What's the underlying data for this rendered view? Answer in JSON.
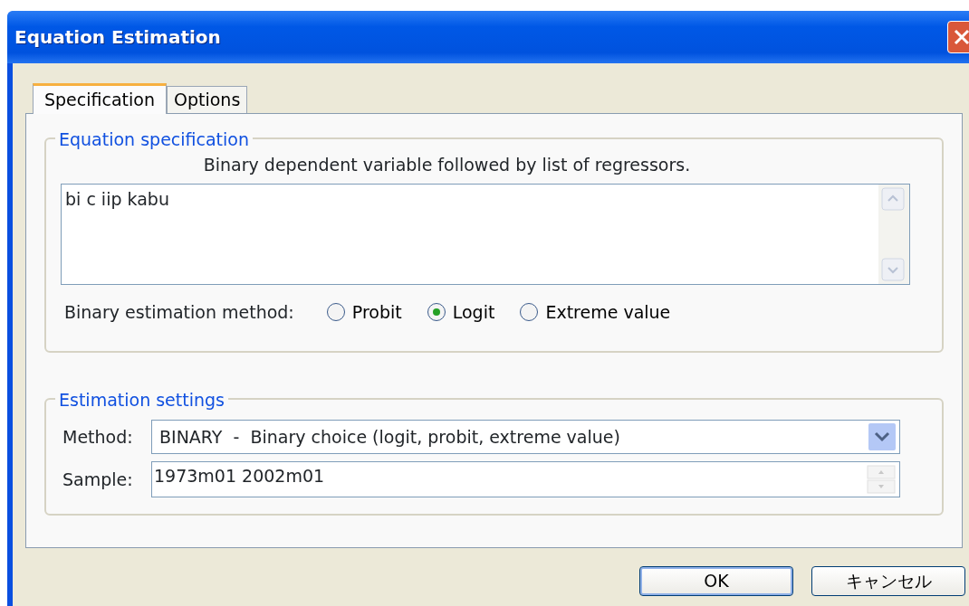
{
  "window": {
    "title": "Equation Estimation"
  },
  "tabs": [
    {
      "label": "Specification",
      "selected": true
    },
    {
      "label": "Options",
      "selected": false
    }
  ],
  "equation_specification": {
    "legend": "Equation specification",
    "instruction": "Binary dependent variable followed by list of regressors.",
    "equation": "bi c iip kabu",
    "method_label": "Binary estimation method:",
    "methods": [
      {
        "label": "Probit",
        "selected": false
      },
      {
        "label": "Logit",
        "selected": true
      },
      {
        "label": "Extreme value",
        "selected": false
      }
    ]
  },
  "estimation_settings": {
    "legend": "Estimation settings",
    "method_label": "Method:",
    "method_value": "BINARY  -  Binary choice (logit, probit, extreme value)",
    "sample_label": "Sample:",
    "sample_value": "1973m01 2002m01"
  },
  "buttons": [
    "OK",
    "キャンセル"
  ]
}
